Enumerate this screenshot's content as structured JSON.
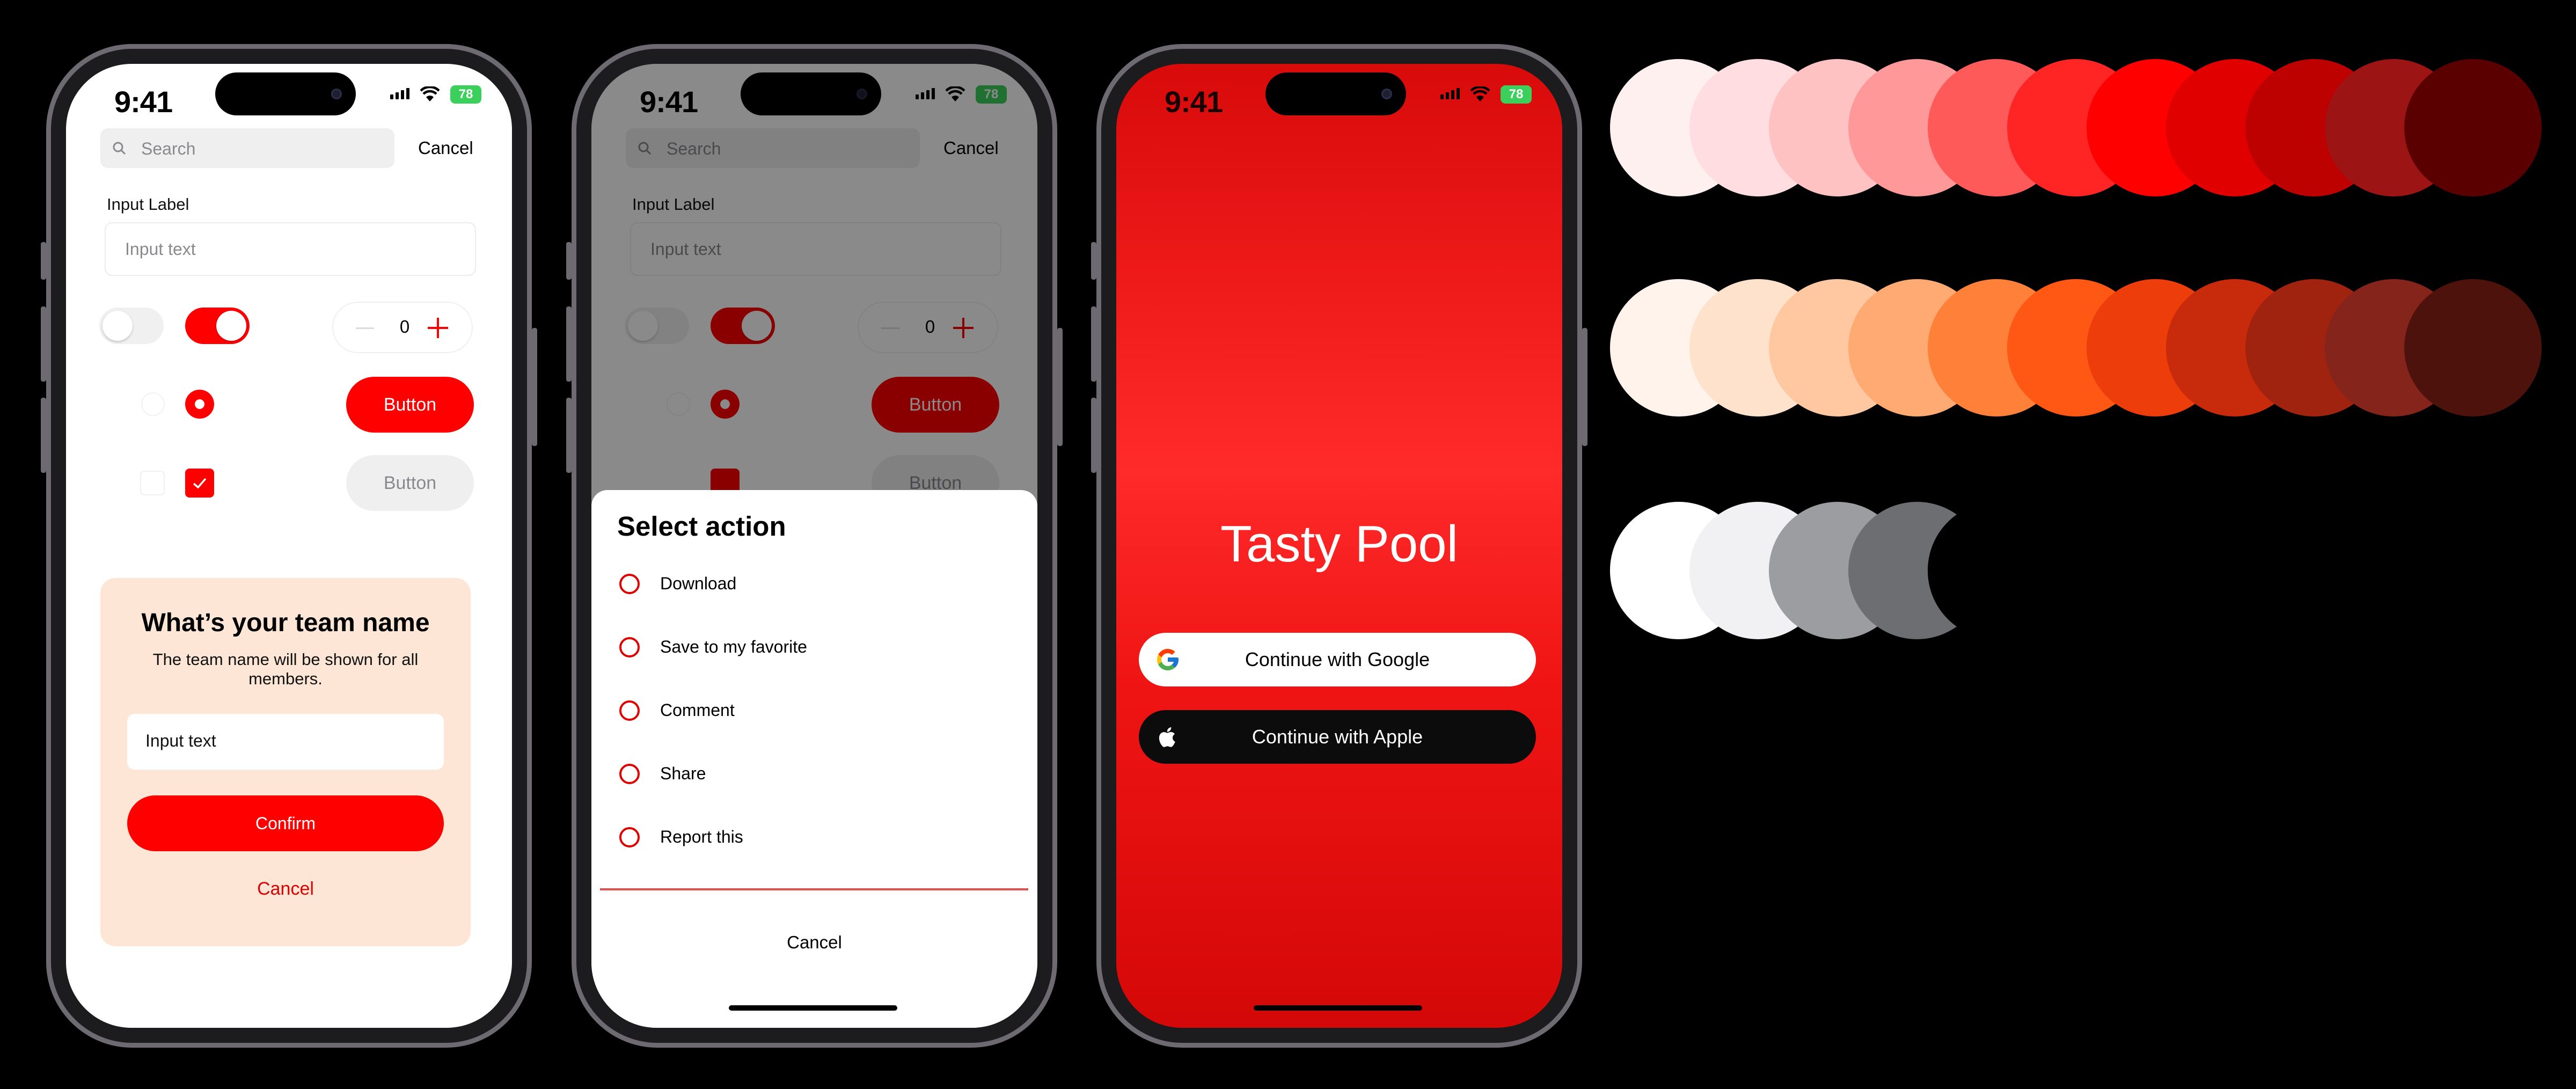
{
  "status": {
    "time": "9:41",
    "battery": "78"
  },
  "phone1": {
    "search_placeholder": "Search",
    "cancel": "Cancel",
    "input_label": "Input Label",
    "input_placeholder": "Input text",
    "stepper_value": "0",
    "button_primary": "Button",
    "button_secondary": "Button",
    "card": {
      "title": "What’s your team name",
      "subtitle": "The team name will be shown for all members.",
      "input_value": "Input text",
      "confirm": "Confirm",
      "cancel": "Cancel"
    }
  },
  "phone2": {
    "sheet_title": "Select action",
    "options": [
      "Download",
      "Save to my favorite",
      "Comment",
      "Share",
      "Report this"
    ],
    "cancel": "Cancel"
  },
  "phone3": {
    "app_title": "Tasty Pool",
    "google_button": "Continue with Google",
    "apple_button": "Continue with Apple"
  },
  "palette": {
    "red": [
      "#fff0f0",
      "#ffdde0",
      "#ffc2c2",
      "#ff9999",
      "#ff5a5a",
      "#ff2525",
      "#ff0000",
      "#e00000",
      "#bd0000",
      "#9c1414",
      "#5a0000"
    ],
    "orange": [
      "#fff3eb",
      "#ffe2cc",
      "#ffc8a0",
      "#ffaa72",
      "#ff8038",
      "#ff5714",
      "#ec3d0a",
      "#c82a0c",
      "#a0230f",
      "#85241a",
      "#4e120c"
    ],
    "gray": [
      "#ffffff",
      "#f1f1f3",
      "#9b9da1",
      "#6c6e72",
      "#000000"
    ]
  }
}
